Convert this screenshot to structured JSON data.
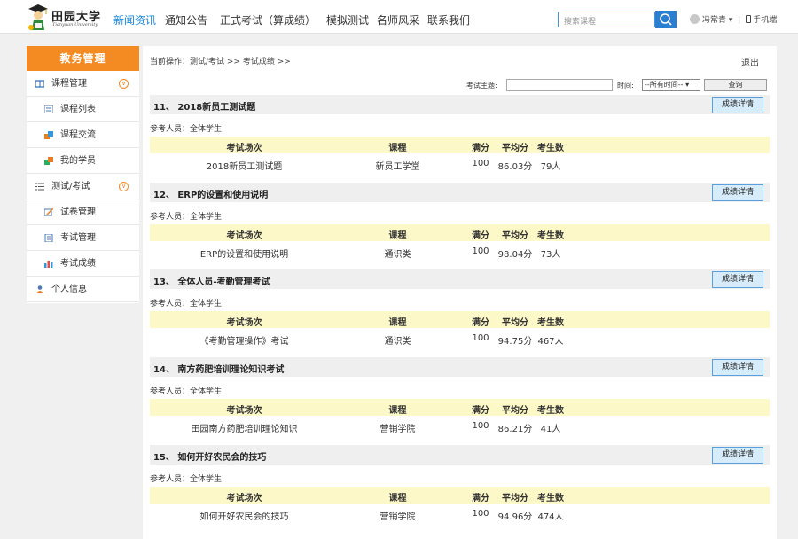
{
  "header": {
    "logo_text": "田园大学",
    "logo_sub": "Tianyuan University",
    "nav": [
      {
        "label": "新闻资讯",
        "active": true
      },
      {
        "label": "通知公告",
        "active": false
      },
      {
        "label": "正式考试（算成绩）",
        "active": false
      },
      {
        "label": "模拟测试",
        "active": false
      },
      {
        "label": "名师风采",
        "active": false
      },
      {
        "label": "联系我们",
        "active": false
      }
    ],
    "search_placeholder": "搜索课程",
    "user_name": "冯常青",
    "mobile_label": "手机端"
  },
  "sidebar": {
    "title": "教务管理",
    "items": [
      {
        "label": "课程管理",
        "type": "group",
        "icon": "book-icon",
        "expanded": true
      },
      {
        "label": "课程列表",
        "type": "sub",
        "icon": "list-icon"
      },
      {
        "label": "课程交流",
        "type": "sub",
        "icon": "chat-icon"
      },
      {
        "label": "我的学员",
        "type": "sub",
        "icon": "users-icon"
      },
      {
        "label": "测试/考试",
        "type": "group",
        "icon": "checklist-icon",
        "expanded": true
      },
      {
        "label": "试卷管理",
        "type": "sub",
        "icon": "edit-icon"
      },
      {
        "label": "考试管理",
        "type": "sub",
        "icon": "document-icon"
      },
      {
        "label": "考试成绩",
        "type": "sub",
        "icon": "bar-chart-icon"
      },
      {
        "label": "个人信息",
        "type": "group",
        "icon": "person-icon"
      }
    ]
  },
  "main": {
    "breadcrumb": "当前操作：测试/考试 >> 考试成绩 >>",
    "logout": "退出",
    "filter": {
      "topic_label": "考试主题:",
      "time_label": "时间:",
      "time_value": "--所有时间-- ▾",
      "query_button": "查询"
    },
    "columns": {
      "name": "考试场次",
      "course": "课程",
      "full": "满分",
      "avg": "平均分",
      "count": "考生数"
    },
    "people_prefix": "参考人员：",
    "detail_button": "成绩详情",
    "records": [
      {
        "index": "11、",
        "title": "2018新员工测试题",
        "people": "全体学生",
        "name": "2018新员工测试题",
        "course": "新员工学堂",
        "full": "100",
        "avg": "86.03分",
        "count": "79人"
      },
      {
        "index": "12、",
        "title": "ERP的设置和使用说明",
        "people": "全体学生",
        "name": "ERP的设置和使用说明",
        "course": "通识类",
        "full": "100",
        "avg": "98.04分",
        "count": "73人"
      },
      {
        "index": "13、",
        "title": "全体人员-考勤管理考试",
        "people": "全体学生",
        "name": "《考勤管理操作》考试",
        "course": "通识类",
        "full": "100",
        "avg": "94.75分",
        "count": "467人"
      },
      {
        "index": "14、",
        "title": "南方药肥培训理论知识考试",
        "people": "全体学生",
        "name": "田园南方药肥培训理论知识",
        "course": "营销学院",
        "full": "100",
        "avg": "86.21分",
        "count": "41人"
      },
      {
        "index": "15、",
        "title": "如何开好农民会的技巧",
        "people": "全体学生",
        "name": "如何开好农民会的技巧",
        "course": "营销学院",
        "full": "100",
        "avg": "94.96分",
        "count": "474人"
      }
    ]
  },
  "colors": {
    "accent": "#f48a22",
    "link": "#1a8ae0",
    "table_head": "#fdf8c8",
    "button": "#d7ecfb"
  }
}
